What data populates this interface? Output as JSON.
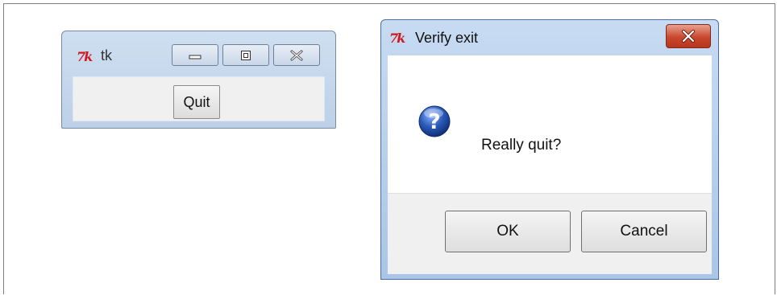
{
  "tk_window": {
    "logo": "7k",
    "title": "tk",
    "controls": {
      "minimize": "minimize-icon",
      "maximize": "maximize-icon",
      "close": "close-icon"
    },
    "quit_label": "Quit"
  },
  "dialog": {
    "logo": "7k",
    "title": "Verify exit",
    "close": "close-icon",
    "icon": "question-icon",
    "message": "Really quit?",
    "ok_label": "OK",
    "cancel_label": "Cancel"
  },
  "colors": {
    "tk_logo": "#d2161c",
    "close_button": "#c9472d",
    "question_icon": "#2a5bb8"
  }
}
